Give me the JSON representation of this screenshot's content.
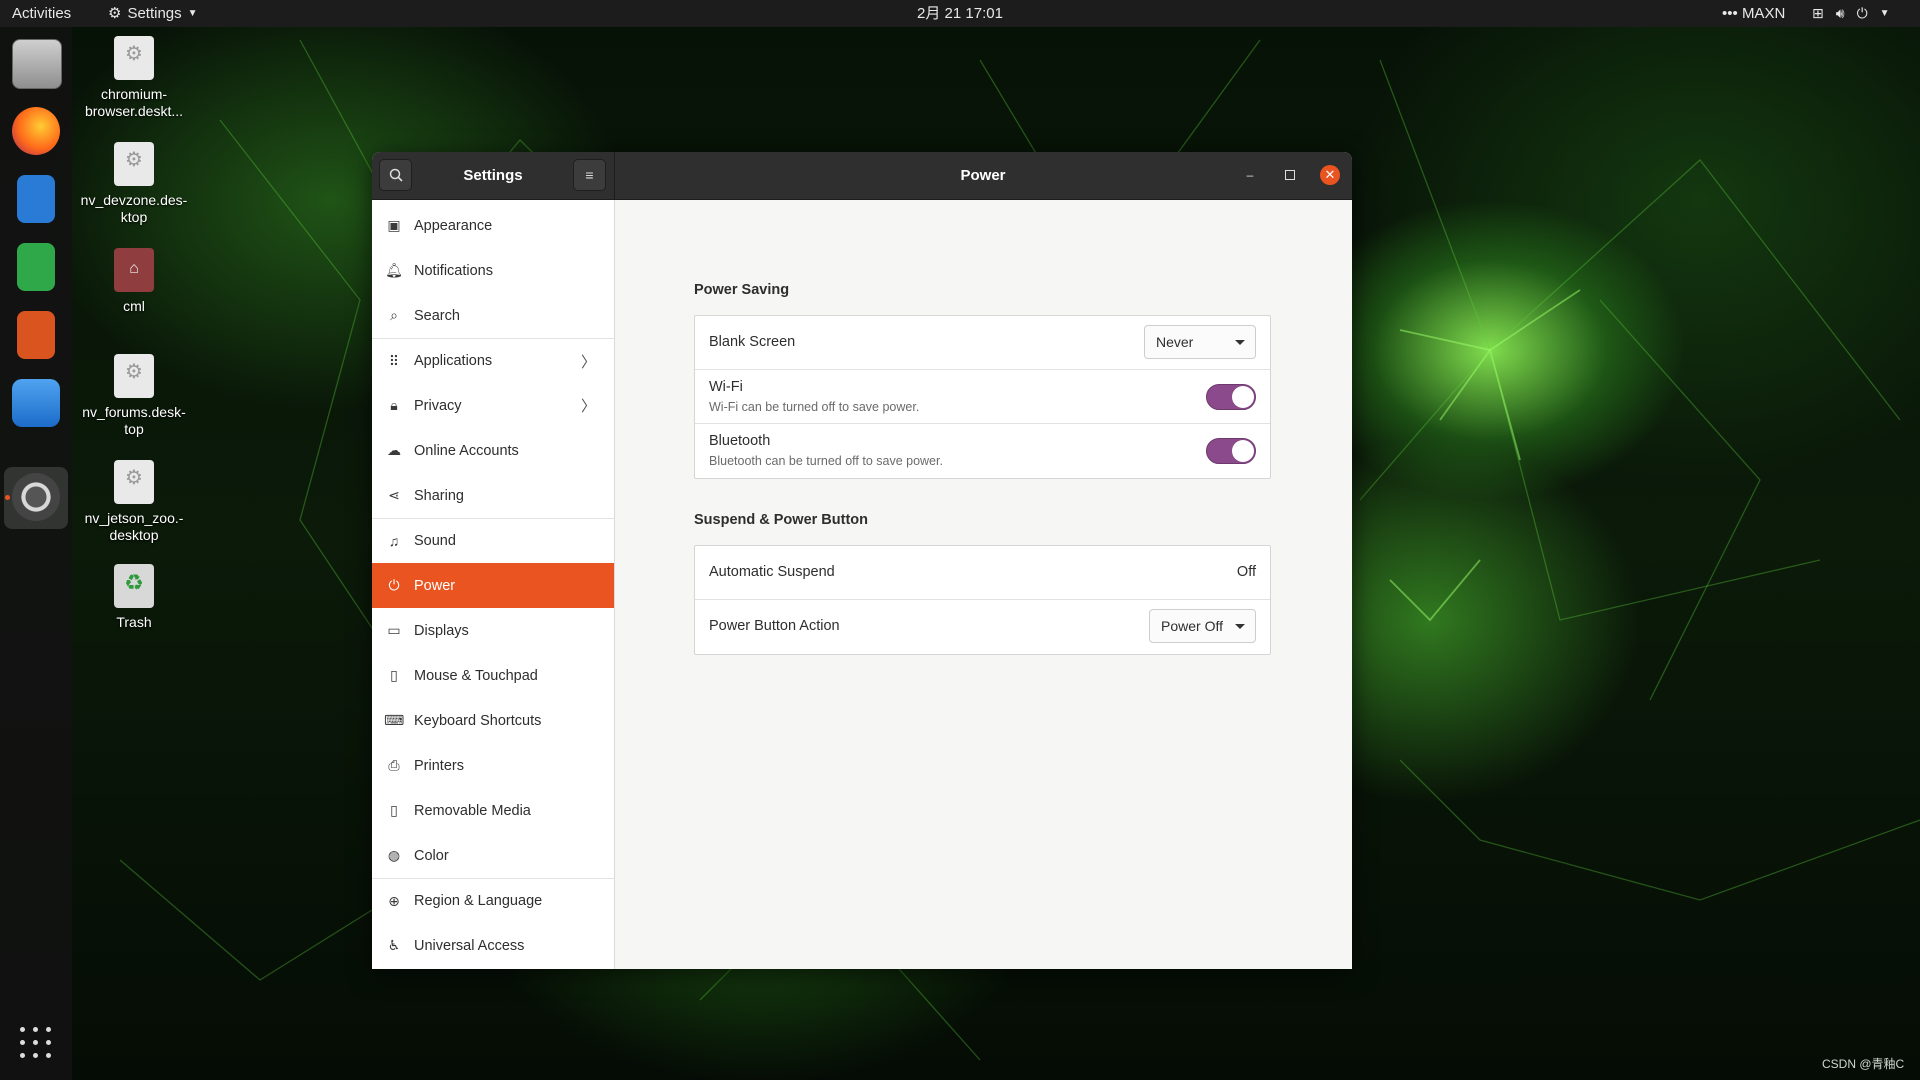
{
  "topbar": {
    "activities": "Activities",
    "app_menu": "Settings",
    "clock": "2月 21  17:01",
    "power_mode": "MAXN"
  },
  "desktop_icons": [
    {
      "label": "chromium-\nbrowser.deskt...",
      "icon": "gear-icon"
    },
    {
      "label": "nv_devzone.des-\nktop",
      "icon": "gear-icon"
    },
    {
      "label": "cml",
      "icon": "home-folder-icon"
    },
    {
      "label": "nv_forums.desk-\ntop",
      "icon": "gear-icon"
    },
    {
      "label": "nv_jetson_zoo.-\ndesktop",
      "icon": "gear-icon"
    },
    {
      "label": "Trash",
      "icon": "trash-icon"
    }
  ],
  "window": {
    "sidebar_title": "Settings",
    "page_title": "Power"
  },
  "sidebar": {
    "items": [
      {
        "label": "Appearance",
        "icon": "appearance-icon",
        "has_chevron": false,
        "separator": false
      },
      {
        "label": "Notifications",
        "icon": "bell-icon",
        "has_chevron": false,
        "separator": false
      },
      {
        "label": "Search",
        "icon": "search-icon",
        "has_chevron": false,
        "separator": false
      },
      {
        "label": "Applications",
        "icon": "grid-icon",
        "has_chevron": true,
        "separator": true
      },
      {
        "label": "Privacy",
        "icon": "lock-icon",
        "has_chevron": true,
        "separator": false
      },
      {
        "label": "Online Accounts",
        "icon": "cloud-icon",
        "has_chevron": false,
        "separator": false
      },
      {
        "label": "Sharing",
        "icon": "share-icon",
        "has_chevron": false,
        "separator": false
      },
      {
        "label": "Sound",
        "icon": "music-note-icon",
        "has_chevron": false,
        "separator": true
      },
      {
        "label": "Power",
        "icon": "power-icon",
        "has_chevron": false,
        "separator": false,
        "active": true
      },
      {
        "label": "Displays",
        "icon": "display-icon",
        "has_chevron": false,
        "separator": false
      },
      {
        "label": "Mouse & Touchpad",
        "icon": "mouse-icon",
        "has_chevron": false,
        "separator": false
      },
      {
        "label": "Keyboard Shortcuts",
        "icon": "keyboard-icon",
        "has_chevron": false,
        "separator": false
      },
      {
        "label": "Printers",
        "icon": "printer-icon",
        "has_chevron": false,
        "separator": false
      },
      {
        "label": "Removable Media",
        "icon": "usb-icon",
        "has_chevron": false,
        "separator": false
      },
      {
        "label": "Color",
        "icon": "color-icon",
        "has_chevron": false,
        "separator": false
      },
      {
        "label": "Region & Language",
        "icon": "globe-icon",
        "has_chevron": false,
        "separator": true
      },
      {
        "label": "Universal Access",
        "icon": "accessibility-icon",
        "has_chevron": false,
        "separator": false
      }
    ]
  },
  "power_saving": {
    "title": "Power Saving",
    "blank_screen": {
      "label": "Blank Screen",
      "value": "Never"
    },
    "wifi": {
      "label": "Wi-Fi",
      "description": "Wi-Fi can be turned off to save power.",
      "enabled": true
    },
    "bluetooth": {
      "label": "Bluetooth",
      "description": "Bluetooth can be turned off to save power.",
      "enabled": true
    }
  },
  "suspend": {
    "title": "Suspend & Power Button",
    "automatic_suspend": {
      "label": "Automatic Suspend",
      "value": "Off"
    },
    "power_button_action": {
      "label": "Power Button Action",
      "value": "Power Off"
    }
  },
  "watermark": "CSDN @青釉C",
  "colors": {
    "accent": "#e95420",
    "toggle_on": "#8b4a8b",
    "headerbar": "#2f2f2f"
  }
}
